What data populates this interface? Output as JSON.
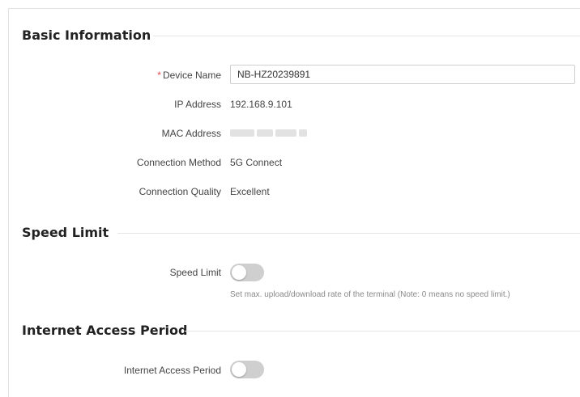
{
  "basic_information": {
    "title": "Basic Information",
    "device_name": {
      "label": "Device Name",
      "required_mark": "*",
      "value": "NB-HZ20239891"
    },
    "ip_address": {
      "label": "IP Address",
      "value": "192.168.9.101"
    },
    "mac_address": {
      "label": "MAC Address"
    },
    "connection_method": {
      "label": "Connection Method",
      "value": "5G Connect"
    },
    "connection_quality": {
      "label": "Connection Quality",
      "value": "Excellent"
    }
  },
  "speed_limit": {
    "title": "Speed Limit",
    "toggle_label": "Speed Limit",
    "enabled": false,
    "hint": "Set max. upload/download rate of the terminal (Note: 0 means no speed limit.)"
  },
  "internet_access_period": {
    "title": "Internet Access Period",
    "toggle_label": "Internet Access Period",
    "enabled": false
  },
  "colors": {
    "required": "#e5484d",
    "toggle_off": "#cfcfcf"
  }
}
